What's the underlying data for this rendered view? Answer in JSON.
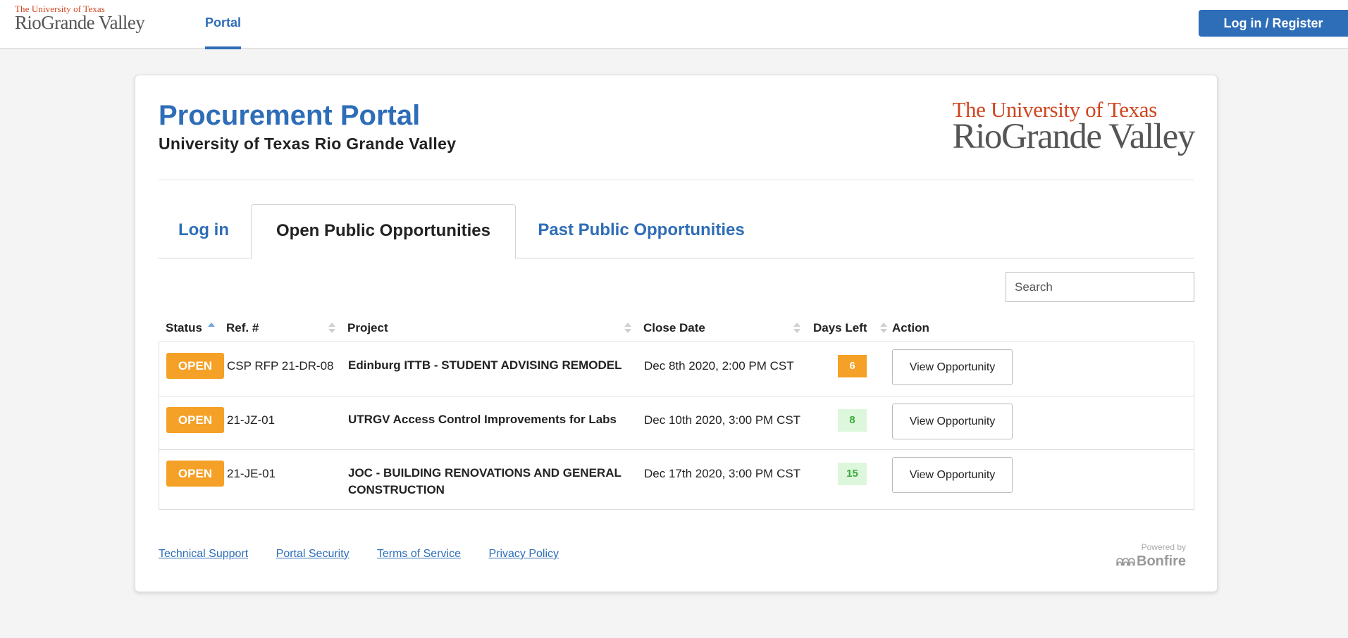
{
  "header": {
    "logo_line1": "The University of Texas",
    "logo_line2": "RioGrande Valley",
    "nav_portal": "Portal",
    "login_register": "Log in / Register"
  },
  "card": {
    "title": "Procurement Portal",
    "subtitle": "University of Texas Rio Grande Valley",
    "logo_line1": "The University of Texas",
    "logo_line2": "RioGrande Valley"
  },
  "tabs": [
    {
      "label": "Log in",
      "active": false
    },
    {
      "label": "Open Public Opportunities",
      "active": true
    },
    {
      "label": "Past Public Opportunities",
      "active": false
    }
  ],
  "search": {
    "placeholder": "Search"
  },
  "table": {
    "columns": [
      "Status",
      "Ref. #",
      "Project",
      "Close Date",
      "Days Left",
      "Action"
    ],
    "rows": [
      {
        "status": "OPEN",
        "ref": "CSP RFP 21-DR-08",
        "project_line1": "Edinburg ITTB - STUDENT ADVISING REMODEL",
        "project_line2": "",
        "close_date": "Dec 8th 2020, 2:00 PM CST",
        "days_left": "6",
        "days_color": "#f5a127",
        "action": "View Opportunity"
      },
      {
        "status": "OPEN",
        "ref": "21-JZ-01",
        "project_line1": "UTRGV Access Control Improvements for Labs",
        "project_line2": "",
        "close_date": "Dec 10th 2020, 3:00 PM CST",
        "days_left": "8",
        "days_color": "#3caa3c",
        "action": "View Opportunity"
      },
      {
        "status": "OPEN",
        "ref": "21-JE-01",
        "project_line1": "JOC - BUILDING RENOVATIONS AND GENERAL",
        "project_line2": "CONSTRUCTION",
        "close_date": "Dec 17th 2020, 3:00 PM CST",
        "days_left": "15",
        "days_color": "#3caa3c",
        "action": "View Opportunity"
      }
    ]
  },
  "footer": {
    "links": [
      "Technical Support",
      "Portal Security",
      "Terms of Service",
      "Privacy Policy"
    ],
    "powered_by": "Powered by",
    "brand": "Bonfire"
  },
  "colors": {
    "accent": "#2e6db7",
    "brand_orange": "#cf4520",
    "status_open": "#f5a127",
    "days_ok_bg": "#dcf7dc"
  }
}
